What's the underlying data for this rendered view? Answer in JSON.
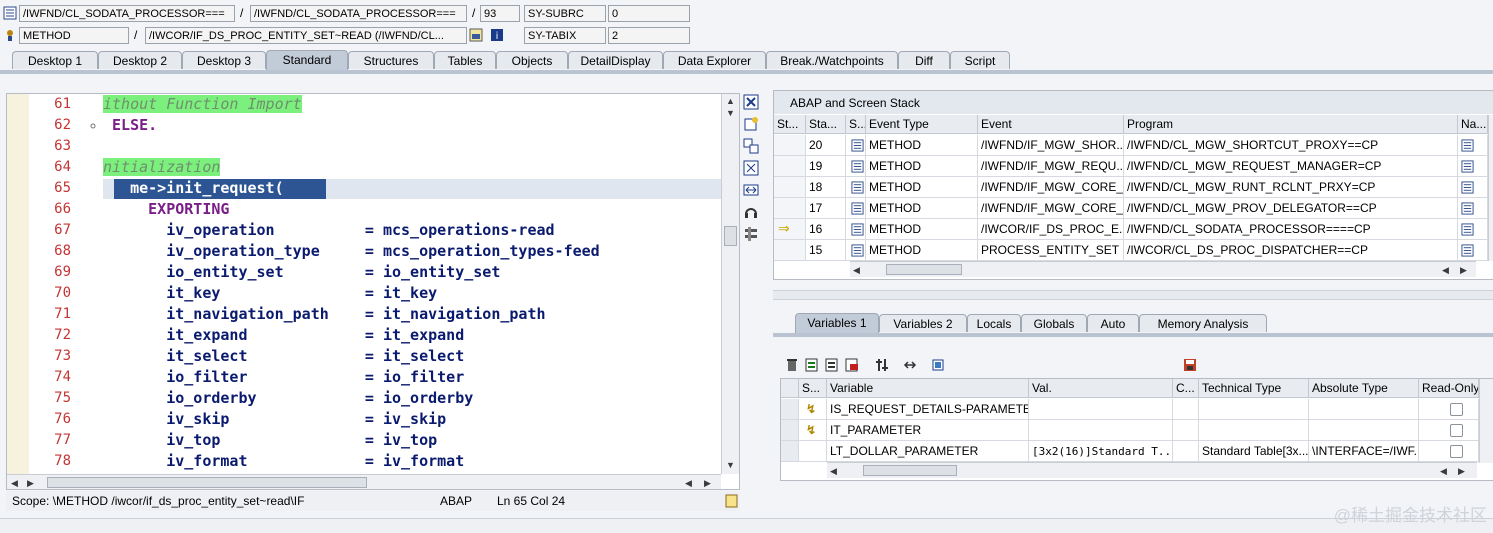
{
  "header": {
    "program_field": "/IWFND/CL_SODATA_PROCESSOR===",
    "include_field": "/IWFND/CL_SODATA_PROCESSOR===",
    "line_number": "93",
    "sy_subrc_label": "SY-SUBRC",
    "sy_subrc_value": "0",
    "event_type_field": "METHOD",
    "event_field": "/IWCOR/IF_DS_PROC_ENTITY_SET~READ (/IWFND/CL...",
    "sy_tabix_label": "SY-TABIX",
    "sy_tabix_value": "2",
    "separator": "/"
  },
  "tabs": [
    {
      "label": "Desktop 1"
    },
    {
      "label": "Desktop 2"
    },
    {
      "label": "Desktop 3"
    },
    {
      "label": "Standard"
    },
    {
      "label": "Structures"
    },
    {
      "label": "Tables"
    },
    {
      "label": "Objects"
    },
    {
      "label": "DetailDisplay"
    },
    {
      "label": "Data Explorer"
    },
    {
      "label": "Break./Watchpoints"
    },
    {
      "label": "Diff"
    },
    {
      "label": "Script"
    }
  ],
  "editor": {
    "lines": [
      {
        "num": "61",
        "text": "ithout Function Import"
      },
      {
        "num": "62",
        "text": " ELSE."
      },
      {
        "num": "63",
        "text": ""
      },
      {
        "num": "64",
        "text": "nitialization"
      },
      {
        "num": "65",
        "text": "   me->init_request("
      },
      {
        "num": "66",
        "text": "     EXPORTING"
      },
      {
        "num": "67",
        "text": "       iv_operation          = mcs_operations-read"
      },
      {
        "num": "68",
        "text": "       iv_operation_type     = mcs_operation_types-feed"
      },
      {
        "num": "69",
        "text": "       io_entity_set         = io_entity_set"
      },
      {
        "num": "70",
        "text": "       it_key                = it_key"
      },
      {
        "num": "71",
        "text": "       it_navigation_path    = it_navigation_path"
      },
      {
        "num": "72",
        "text": "       it_expand             = it_expand"
      },
      {
        "num": "73",
        "text": "       it_select             = it_select"
      },
      {
        "num": "74",
        "text": "       io_filter             = io_filter"
      },
      {
        "num": "75",
        "text": "       io_orderby            = io_orderby"
      },
      {
        "num": "76",
        "text": "       iv_skip               = iv_skip"
      },
      {
        "num": "77",
        "text": "       iv_top                = iv_top"
      },
      {
        "num": "78",
        "text": "       iv_format             = iv_format"
      }
    ],
    "status": {
      "scope": "Scope: \\METHOD /iwcor/if_ds_proc_entity_set~read\\IF",
      "language": "ABAP",
      "position": "Ln  65 Col  24"
    }
  },
  "stack": {
    "title": "ABAP and Screen Stack",
    "columns": [
      "St...",
      "Sta...",
      "S...",
      "Event Type",
      "Event",
      "Program",
      "Na..."
    ],
    "rows": [
      {
        "level": "20",
        "event_type": "METHOD",
        "event": "/IWFND/IF_MGW_SHOR...",
        "program": "/IWFND/CL_MGW_SHORTCUT_PROXY==CP",
        "current": false
      },
      {
        "level": "19",
        "event_type": "METHOD",
        "event": "/IWFND/IF_MGW_REQU...",
        "program": "/IWFND/CL_MGW_REQUEST_MANAGER=CP",
        "current": false
      },
      {
        "level": "18",
        "event_type": "METHOD",
        "event": "/IWFND/IF_MGW_CORE_...",
        "program": "/IWFND/CL_MGW_RUNT_RCLNT_PRXY=CP",
        "current": false
      },
      {
        "level": "17",
        "event_type": "METHOD",
        "event": "/IWFND/IF_MGW_CORE_...",
        "program": "/IWFND/CL_MGW_PROV_DELEGATOR==CP",
        "current": false
      },
      {
        "level": "16",
        "event_type": "METHOD",
        "event": "/IWCOR/IF_DS_PROC_E...",
        "program": "/IWFND/CL_SODATA_PROCESSOR====CP",
        "current": true
      },
      {
        "level": "15",
        "event_type": "METHOD",
        "event": "PROCESS_ENTITY_SET",
        "program": "/IWCOR/CL_DS_PROC_DISPATCHER==CP",
        "current": false
      }
    ]
  },
  "var_tabs": [
    {
      "label": "Variables 1"
    },
    {
      "label": "Variables 2"
    },
    {
      "label": "Locals"
    },
    {
      "label": "Globals"
    },
    {
      "label": "Auto"
    },
    {
      "label": "Memory Analysis"
    }
  ],
  "variables": {
    "columns": [
      "S...",
      "Variable",
      "Val.",
      "C...",
      "Technical Type",
      "Absolute Type",
      "Read-Only"
    ],
    "rows": [
      {
        "name": "IS_REQUEST_DETAILS-PARAMETE...",
        "value": "",
        "tech_type": "",
        "abs_type": ""
      },
      {
        "name": "IT_PARAMETER",
        "value": "",
        "tech_type": "",
        "abs_type": ""
      },
      {
        "name": "LT_DOLLAR_PARAMETER",
        "value": "[3x2(16)]Standard T...",
        "tech_type": "Standard Table[3x...",
        "abs_type": "\\INTERFACE=/IWF..."
      }
    ]
  },
  "watermark": "@稀土掘金技术社区"
}
